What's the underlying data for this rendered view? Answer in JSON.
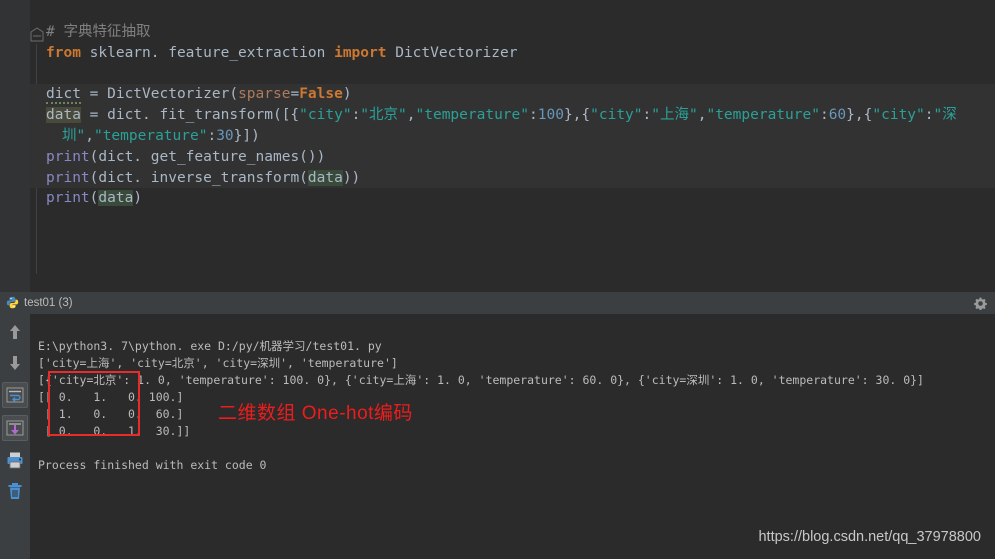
{
  "editor": {
    "fold_icon": "code-fold-icon",
    "lines": [
      {
        "id": "comment",
        "highlight": false,
        "segments": [
          {
            "cls": "cmt",
            "text": "# 字典特征抽取"
          }
        ]
      },
      {
        "id": "import",
        "highlight": false,
        "segments": [
          {
            "cls": "kw",
            "text": "from"
          },
          {
            "cls": "ident",
            "text": " sklearn. feature_extraction "
          },
          {
            "cls": "kw",
            "text": "import"
          },
          {
            "cls": "ident",
            "text": " DictVectorizer"
          }
        ]
      },
      {
        "id": "blank1",
        "highlight": false,
        "segments": [
          {
            "cls": "ident",
            "text": ""
          }
        ]
      },
      {
        "id": "dict-assign",
        "highlight": true,
        "segments": [
          {
            "cls": "ident squig",
            "text": "dict"
          },
          {
            "cls": "ident",
            "text": " = DictVectorizer("
          },
          {
            "cls": "param",
            "text": "sparse"
          },
          {
            "cls": "ident",
            "text": "="
          },
          {
            "cls": "kw",
            "text": "False"
          },
          {
            "cls": "ident",
            "text": ")"
          }
        ]
      },
      {
        "id": "data-assign",
        "highlight": true,
        "segments": [
          {
            "cls": "ident datahl",
            "text": "data"
          },
          {
            "cls": "ident",
            "text": " = dict. fit_transform([{"
          },
          {
            "cls": "str",
            "text": "\"city\""
          },
          {
            "cls": "ident",
            "text": ":"
          },
          {
            "cls": "str",
            "text": "\"北京\""
          },
          {
            "cls": "ident",
            "text": ","
          },
          {
            "cls": "str",
            "text": "\"temperature\""
          },
          {
            "cls": "ident",
            "text": ":"
          },
          {
            "cls": "num",
            "text": "100"
          },
          {
            "cls": "ident",
            "text": "},{"
          },
          {
            "cls": "str",
            "text": "\"city\""
          },
          {
            "cls": "ident",
            "text": ":"
          },
          {
            "cls": "str",
            "text": "\"上海\""
          },
          {
            "cls": "ident",
            "text": ","
          },
          {
            "cls": "str",
            "text": "\"temperature\""
          },
          {
            "cls": "ident",
            "text": ":"
          },
          {
            "cls": "num",
            "text": "60"
          },
          {
            "cls": "ident",
            "text": "},{"
          },
          {
            "cls": "str",
            "text": "\"city\""
          },
          {
            "cls": "ident",
            "text": ":"
          },
          {
            "cls": "str",
            "text": "\"深"
          }
        ]
      },
      {
        "id": "data-wrap",
        "highlight": true,
        "indent": true,
        "segments": [
          {
            "cls": "str",
            "text": "圳\""
          },
          {
            "cls": "ident",
            "text": ","
          },
          {
            "cls": "str",
            "text": "\"temperature\""
          },
          {
            "cls": "ident",
            "text": ":"
          },
          {
            "cls": "num",
            "text": "30"
          },
          {
            "cls": "ident",
            "text": "}])"
          }
        ]
      },
      {
        "id": "print-names",
        "highlight": true,
        "segments": [
          {
            "cls": "print",
            "text": "print"
          },
          {
            "cls": "ident",
            "text": "(dict. get_feature_names())"
          }
        ]
      },
      {
        "id": "print-inverse",
        "highlight": true,
        "segments": [
          {
            "cls": "print",
            "text": "print"
          },
          {
            "cls": "ident",
            "text": "(dict. inverse_transform("
          },
          {
            "cls": "ident var-hl",
            "text": "data"
          },
          {
            "cls": "ident",
            "text": "))"
          }
        ]
      },
      {
        "id": "print-data",
        "highlight": false,
        "segments": [
          {
            "cls": "print",
            "text": "print"
          },
          {
            "cls": "ident",
            "text": "("
          },
          {
            "cls": "ident var-hl",
            "text": "data"
          },
          {
            "cls": "ident",
            "text": ")"
          }
        ]
      }
    ]
  },
  "console": {
    "tab_label": "test01 (3)",
    "tab_icon": "python-icon",
    "settings_icon": "gear-icon",
    "sidebar_icons": [
      {
        "name": "scroll-up-icon",
        "framed": false
      },
      {
        "name": "scroll-down-icon",
        "framed": false
      },
      {
        "name": "soft-wrap-icon",
        "framed": true
      },
      {
        "name": "scroll-to-end-icon",
        "framed": true
      },
      {
        "name": "print-icon",
        "framed": false
      },
      {
        "name": "trash-icon",
        "framed": false
      }
    ],
    "output_lines": [
      "E:\\python3. 7\\python. exe D:/py/机器学习/test01. py",
      "['city=上海', 'city=北京', 'city=深圳', 'temperature']",
      "[{'city=北京': 1. 0, 'temperature': 100. 0}, {'city=上海': 1. 0, 'temperature': 60. 0}, {'city=深圳': 1. 0, 'temperature': 30. 0}]",
      "[[ 0.   1.   0. 100.]",
      " [ 1.   0.   0.  60.]",
      " [ 0.   0.   1.  30.]]",
      "",
      "Process finished with exit code 0"
    ]
  },
  "annotation": {
    "text": "二维数组 One-hot编码",
    "color": "#ee1c1c",
    "box_label": "one-hot-matrix-highlight"
  },
  "watermark": {
    "text": "https://blog.csdn.net/qq_37978800"
  }
}
